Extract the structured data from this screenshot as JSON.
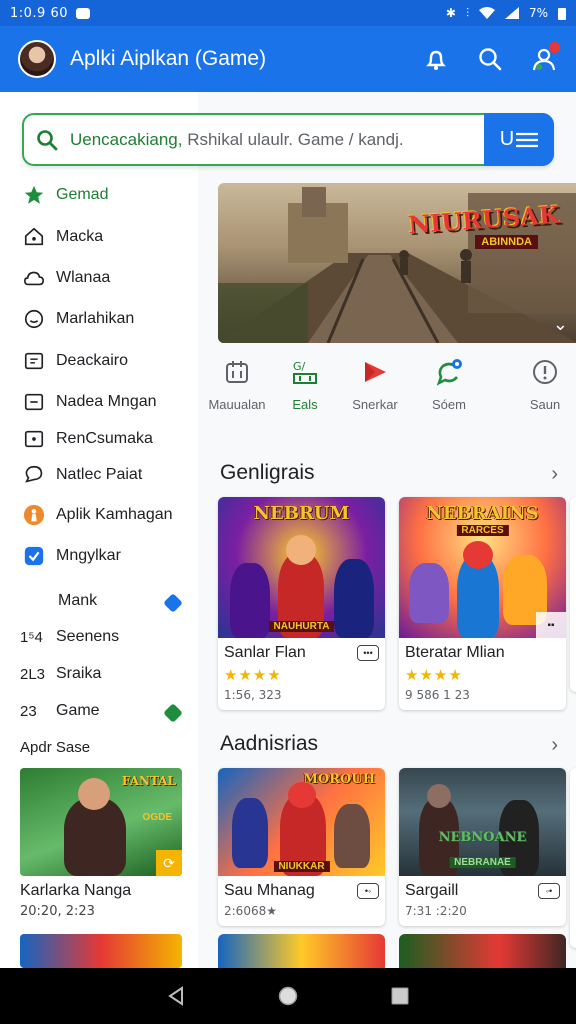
{
  "status_bar": {
    "time": "1:0.9 60",
    "battery": "7%"
  },
  "app_bar": {
    "title": "Aplki Aiplkan (Game)"
  },
  "search": {
    "query_prefix": "Uencacakiang,",
    "query_rest": " Rshikal ulaulr. Game / kandj."
  },
  "sidebar": {
    "items": [
      {
        "label": "Gemad",
        "icon": "star-icon"
      },
      {
        "label": "Macka",
        "icon": "home-icon"
      },
      {
        "label": "Wlanaa",
        "icon": "cloud-icon"
      },
      {
        "label": "Marlahikan",
        "icon": "smile-icon"
      },
      {
        "label": "Deackairo",
        "icon": "list-box-icon"
      },
      {
        "label": "Nadea Mngan",
        "icon": "minus-box-icon"
      },
      {
        "label": "RenCsumaka",
        "icon": "dot-box-icon"
      },
      {
        "label": "Natlec Paiat",
        "icon": "chat-icon"
      },
      {
        "label": "Aplik Kamhagan",
        "icon": "person-orange-icon"
      },
      {
        "label": "Mngylkar",
        "icon": "check-blue-icon"
      }
    ],
    "numbered": [
      {
        "num": "",
        "label": "Mank"
      },
      {
        "num": "1⁵4",
        "label": "Seenens"
      },
      {
        "num": "2L3",
        "label": "Sraika"
      },
      {
        "num": "23",
        "label": "Game"
      }
    ],
    "section_label": "Apdr Sase",
    "card": {
      "title": "Karlarka Nanga",
      "meta": "20:20, 2:23",
      "art_title": "FANTAL",
      "art_sub": "OGDE"
    }
  },
  "banner": {
    "logo": "NIURUSAK",
    "sub": "ABINNDA"
  },
  "categories": [
    {
      "label": "Mauualan",
      "icon": "calendar-icon"
    },
    {
      "label": "Eals",
      "icon": "game-icon"
    },
    {
      "label": "Snerkar",
      "icon": "play-icon"
    },
    {
      "label": "Sóem",
      "icon": "speech-icon"
    },
    {
      "label": "Saun",
      "icon": "info-icon"
    }
  ],
  "sections": [
    {
      "title": "Genligrais",
      "cards": [
        {
          "title": "Sanlar Flan",
          "rating": "★★★★",
          "meta": "1:56, 323",
          "art_title": "NEBRUM",
          "art_sub": "NAUHURTA"
        },
        {
          "title": "Bteratar Mlian",
          "rating": "★★★★",
          "meta": "9 586 1 23",
          "art_title": "NEBRAINS",
          "art_sub": "RARCES"
        }
      ]
    },
    {
      "title": "Aadnisrias",
      "cards": [
        {
          "title": "Sau Mhanag",
          "rating": "",
          "meta": "2:6068★",
          "art_title": "MOROUH",
          "art_sub": "NIUKKAR"
        },
        {
          "title": "Sargaill",
          "rating": "",
          "meta": "7:31 :2:20",
          "art_title": "NEBNOANE",
          "art_sub": "NEBRANAE"
        }
      ]
    }
  ],
  "colors": {
    "primary": "#1a73e8",
    "accent_green": "#1e7e34",
    "star": "#f4b400"
  }
}
